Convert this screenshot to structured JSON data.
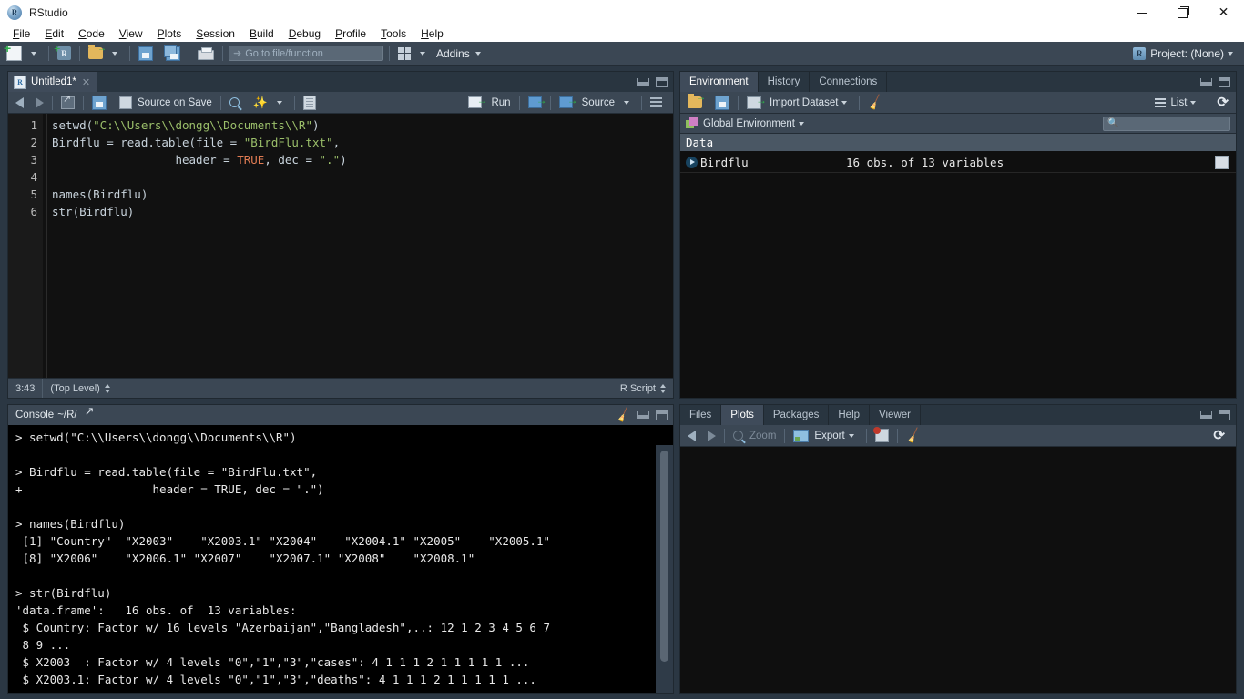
{
  "window": {
    "title": "RStudio",
    "app_icon": "r-logo-icon",
    "controls": {
      "minimize": "minimize-icon",
      "restore": "restore-icon",
      "close": "close-icon"
    }
  },
  "menubar": {
    "items": [
      {
        "label": "File",
        "accel": "F"
      },
      {
        "label": "Edit",
        "accel": "E"
      },
      {
        "label": "Code",
        "accel": "C"
      },
      {
        "label": "View",
        "accel": "V"
      },
      {
        "label": "Plots",
        "accel": "P"
      },
      {
        "label": "Session",
        "accel": "S"
      },
      {
        "label": "Build",
        "accel": "B"
      },
      {
        "label": "Debug",
        "accel": "D"
      },
      {
        "label": "Profile",
        "accel": "P"
      },
      {
        "label": "Tools",
        "accel": "T"
      },
      {
        "label": "Help",
        "accel": "H"
      }
    ]
  },
  "toolbar": {
    "new_file_icon": "new-file-icon",
    "new_project_icon": "new-project-icon",
    "open_file_icon": "open-file-icon",
    "save_icon": "save-icon",
    "save_all_icon": "save-all-icon",
    "print_icon": "print-icon",
    "goto_placeholder": "Go to file/function",
    "panes_icon": "panes-layout-icon",
    "addins_label": "Addins",
    "project_label": "Project: (None)"
  },
  "source": {
    "tab_label": "Untitled1*",
    "toolbar": {
      "back_icon": "back-arrow-icon",
      "forward_icon": "forward-arrow-icon",
      "show_in_new_window_icon": "show-in-new-window-icon",
      "save_icon": "save-icon",
      "source_on_save_label": "Source on Save",
      "find_icon": "find-replace-icon",
      "magic_icon": "code-tools-icon",
      "compile_report_icon": "compile-report-icon",
      "run_label": "Run",
      "rerun_icon": "rerun-icon",
      "source_label": "Source",
      "outline_icon": "document-outline-icon"
    },
    "lines": [
      "1",
      "2",
      "3",
      "4",
      "5",
      "6"
    ],
    "code": [
      [
        {
          "t": "setwd(",
          "c": "plain"
        },
        {
          "t": "\"C:\\\\Users\\\\dongg\\\\Documents\\\\R\"",
          "c": "str"
        },
        {
          "t": ")",
          "c": "plain"
        }
      ],
      [
        {
          "t": "Birdflu = read.table(file = ",
          "c": "plain"
        },
        {
          "t": "\"BirdFlu.txt\"",
          "c": "str"
        },
        {
          "t": ",",
          "c": "plain"
        }
      ],
      [
        {
          "t": "                  header = ",
          "c": "plain"
        },
        {
          "t": "TRUE",
          "c": "kw"
        },
        {
          "t": ", dec = ",
          "c": "plain"
        },
        {
          "t": "\".\"",
          "c": "str"
        },
        {
          "t": ")",
          "c": "plain"
        }
      ],
      [],
      [
        {
          "t": "names(Birdflu)",
          "c": "plain"
        }
      ],
      [
        {
          "t": "str(Birdflu)",
          "c": "plain"
        }
      ]
    ],
    "status": {
      "cursor_position": "3:43",
      "scope": "(Top Level)",
      "file_type": "R Script"
    }
  },
  "console": {
    "title": "Console",
    "path": "~/R/",
    "new_window_icon": "show-in-new-window-icon",
    "clear_icon": "clear-console-icon",
    "lines": [
      "> setwd(\"C:\\\\Users\\\\dongg\\\\Documents\\\\R\")",
      "",
      "> Birdflu = read.table(file = \"BirdFlu.txt\",",
      "+                   header = TRUE, dec = \".\")",
      "",
      "> names(Birdflu)",
      " [1] \"Country\"  \"X2003\"    \"X2003.1\" \"X2004\"    \"X2004.1\" \"X2005\"    \"X2005.1\"",
      " [8] \"X2006\"    \"X2006.1\" \"X2007\"    \"X2007.1\" \"X2008\"    \"X2008.1\"",
      "",
      "> str(Birdflu)",
      "'data.frame':   16 obs. of  13 variables:",
      " $ Country: Factor w/ 16 levels \"Azerbaijan\",\"Bangladesh\",..: 12 1 2 3 4 5 6 7",
      " 8 9 ...",
      " $ X2003  : Factor w/ 4 levels \"0\",\"1\",\"3\",\"cases\": 4 1 1 1 2 1 1 1 1 1 ...",
      " $ X2003.1: Factor w/ 4 levels \"0\",\"1\",\"3\",\"deaths\": 4 1 1 1 2 1 1 1 1 1 ..."
    ]
  },
  "environment": {
    "tabs": [
      {
        "label": "Environment",
        "active": true
      },
      {
        "label": "History",
        "active": false
      },
      {
        "label": "Connections",
        "active": false
      }
    ],
    "toolbar": {
      "load_icon": "load-workspace-icon",
      "save_icon": "save-workspace-icon",
      "import_dataset_label": "Import Dataset",
      "clear_icon": "clear-workspace-icon",
      "view_mode_label": "List",
      "view_mode_icon": "list-view-icon",
      "refresh_icon": "refresh-icon",
      "search_placeholder": ""
    },
    "scope_label": "Global Environment",
    "scope_icon": "global-environment-icon",
    "section_label": "Data",
    "objects": [
      {
        "name": "Birdflu",
        "description": "16 obs. of 13 variables",
        "expand_icon": "expand-arrow-icon",
        "view_icon": "view-data-grid-icon"
      }
    ]
  },
  "plots": {
    "tabs": [
      {
        "label": "Files",
        "active": false
      },
      {
        "label": "Plots",
        "active": true
      },
      {
        "label": "Packages",
        "active": false
      },
      {
        "label": "Help",
        "active": false
      },
      {
        "label": "Viewer",
        "active": false
      }
    ],
    "toolbar": {
      "back_icon": "back-arrow-icon",
      "forward_icon": "forward-arrow-icon",
      "zoom_label": "Zoom",
      "zoom_icon": "zoom-icon",
      "export_label": "Export",
      "export_icon": "export-icon",
      "remove_plot_icon": "remove-plot-icon",
      "clear_plots_icon": "clear-all-plots-icon",
      "refresh_icon": "refresh-icon"
    }
  }
}
